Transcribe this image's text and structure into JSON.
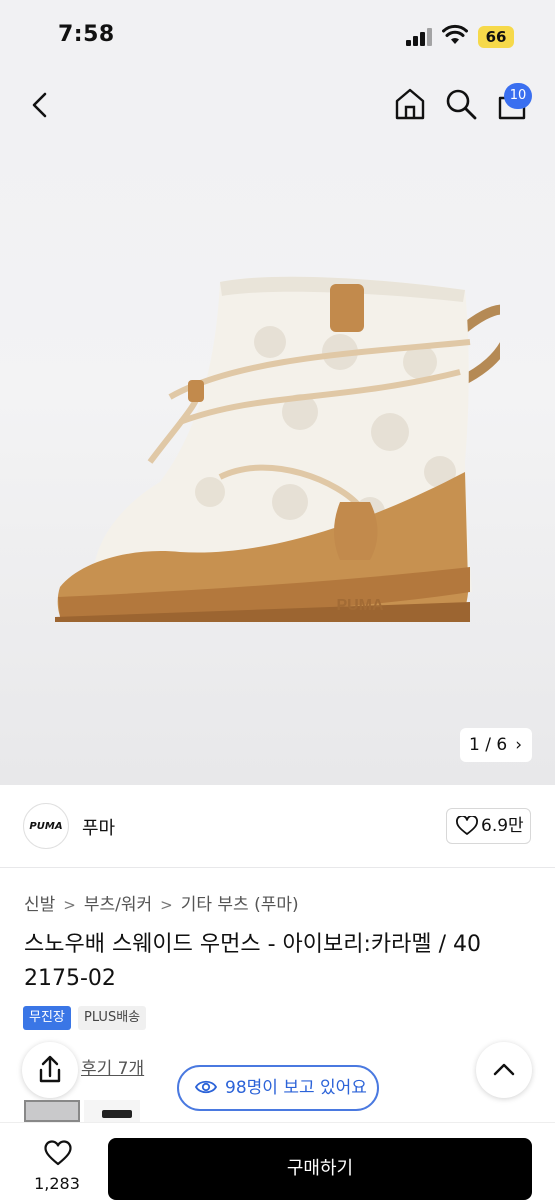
{
  "status": {
    "time": "7:58",
    "battery": "66"
  },
  "nav": {
    "cart_count": "10"
  },
  "gallery": {
    "counter": "1 / 6"
  },
  "brand": {
    "logo_text": "PUMA",
    "name": "푸마",
    "likes": "6.9만"
  },
  "breadcrumb": {
    "items": [
      "신발",
      "부츠/워커",
      "기타 부츠 (푸마)"
    ]
  },
  "product": {
    "title": "스노우배 스웨이드 우먼스 - 아이보리:카라멜 / 40 2175-02"
  },
  "tags": {
    "delivery": "무진장",
    "plus": "PLUS배송"
  },
  "reviews": {
    "label": "후기 7개"
  },
  "viewers": {
    "label": "98명이 보고 있어요"
  },
  "bottom": {
    "wish_count": "1,283",
    "buy_label": "구매하기"
  },
  "colors": {
    "accent": "#3a6ff0",
    "buy": "#000000",
    "pill": "#2c63d8"
  }
}
